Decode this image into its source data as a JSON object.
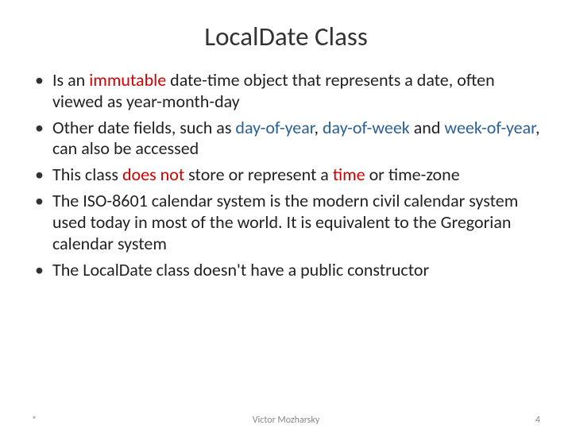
{
  "title": "LocalDate Class",
  "bullets": {
    "b1": {
      "t1": "Is an ",
      "red1": "immutable",
      "t2": " date-time object that represents a date, often viewed as year-month-day"
    },
    "b2": {
      "t1": "Other date fields, such as ",
      "blue1": "day-of-year",
      "t2": ", ",
      "blue2": "day-of-week",
      "t3": " and ",
      "blue3": "week-of-year",
      "t4": ", can also be accessed"
    },
    "b3": {
      "t1": "This class ",
      "red1": "does not",
      "t2": " store or represent a ",
      "red2": "time",
      "t3": " or time-zone"
    },
    "b4": {
      "t1": "The ISO-8601 calendar system is the modern civil calendar system used today in most of the world. It is equivalent to the Gregorian calendar system"
    },
    "b5": {
      "t1": "The LocalDate class doesn't have a public constructor"
    }
  },
  "footer": {
    "star": "*",
    "author": "Victor Mozharsky",
    "page": "4"
  }
}
